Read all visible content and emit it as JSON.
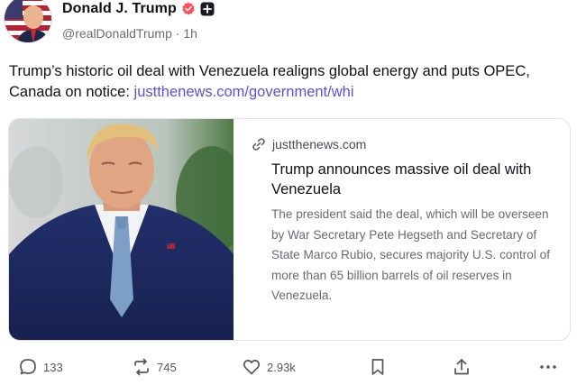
{
  "author": {
    "display_name": "Donald J. Trump",
    "handle": "@realDonaldTrump",
    "separator": "·",
    "time": "1h",
    "avatar_icon": "flag-portrait-avatar",
    "verified_icon": "verified-badge-icon",
    "verified_color": "#ff4b5c",
    "affiliation_icon": "plus-badge-icon"
  },
  "post": {
    "text": "Trump’s historic oil deal with Venezuela realigns global energy and puts OPEC, Canada on notice: ",
    "link_text": "justthenews.com/government/whi",
    "link_color": "#5d4fd8"
  },
  "card": {
    "domain": "justthenews.com",
    "title": "Trump announces massive oil deal with Venezuela",
    "description": "The president said the deal, which will be overseen by War Secretary Pete Hegseth and Secretary of State Marco Rubio, secures majority U.S. control of more than 65 billion barrels of oil reserves in Venezuela.",
    "image_subject": "portrait-photo"
  },
  "actions": {
    "replies": "133",
    "reposts": "745",
    "likes": "2.93k"
  }
}
